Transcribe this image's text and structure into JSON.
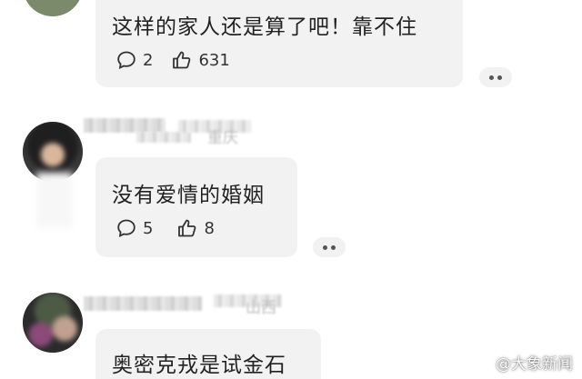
{
  "comments": [
    {
      "text": "这样的家人还是算了吧！靠不住",
      "reply_count": "2",
      "like_count": "631"
    },
    {
      "user_location_fragment": "重庆",
      "text": "没有爱情的婚姻",
      "reply_count": "5",
      "like_count": "8"
    },
    {
      "user_location_fragment": "山西",
      "text": "奥密克戎是试金石"
    }
  ],
  "watermark": {
    "text": "@大象新闻"
  },
  "icons": {
    "reply": "comment-bubble-icon",
    "like": "thumbs-up-icon",
    "more": "more-options-icon"
  }
}
